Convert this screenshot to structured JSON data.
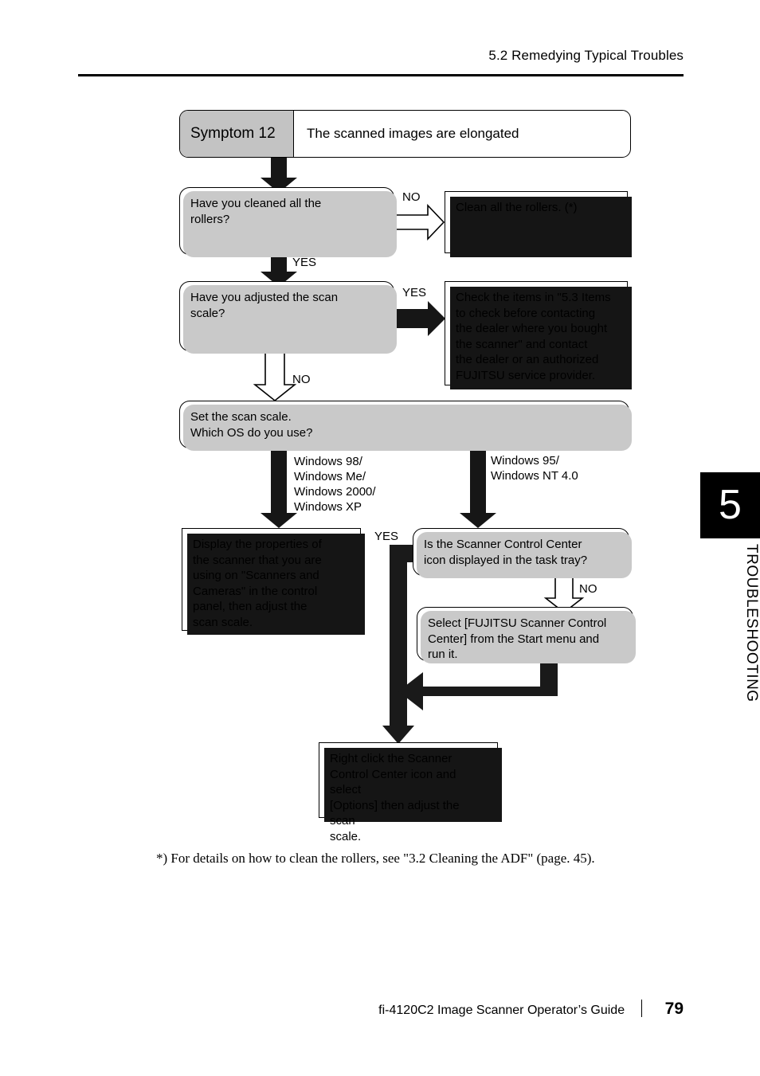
{
  "header": {
    "section_title": "5.2 Remedying Typical Troubles"
  },
  "chapter_tab": {
    "number": "5",
    "label": "TROUBLESHOOTING"
  },
  "footer": {
    "guide_title": "fi-4120C2 Image Scanner Operator’s Guide",
    "page_number": "79"
  },
  "flowchart": {
    "symptom": {
      "label": "Symptom 12",
      "text": "The scanned images are elongated"
    },
    "boxes": {
      "cleaned_rollers": "Have you cleaned all the\nrollers?",
      "clean_rollers_action": "Clean all the rollers. (*)",
      "adjusted_scale": "Have you adjusted the scan\nscale?",
      "check_items_action": "Check the items in \"5.3 Items\nto check before contacting\nthe dealer where you bought\nthe scanner\" and contact\nthe dealer or an authorized\nFUJITSU service provider.",
      "set_scan_scale": "Set the scan scale.\nWhich OS do you use?",
      "display_properties_action": "Display the properties of\nthe scanner that you are\nusing on \"Scanners and\nCameras\" in the control\npanel, then adjust the\nscan scale.",
      "scc_icon_question": "Is the Scanner Control Center\nicon displayed in the task tray?",
      "select_scc_action": "Select [FUJITSU Scanner Control\nCenter] from the Start menu and\nrun it.",
      "right_click_action": "Right click the Scanner\nControl Center icon and select\n[Options] then adjust the scan\nscale."
    },
    "labels": {
      "no_rollers": "NO",
      "yes_rollers": "YES",
      "yes_scale": "YES",
      "no_scale": "NO",
      "branch_left_os": "Windows 98/\nWindows Me/\nWindows 2000/\nWindows XP",
      "branch_right_os": "Windows 95/\nWindows NT 4.0",
      "yes_scc": "YES",
      "no_scc": "NO"
    }
  },
  "footnote": "*) For details on how to clean the rollers, see \"3.2 Cleaning the ADF\" (page. 45)."
}
